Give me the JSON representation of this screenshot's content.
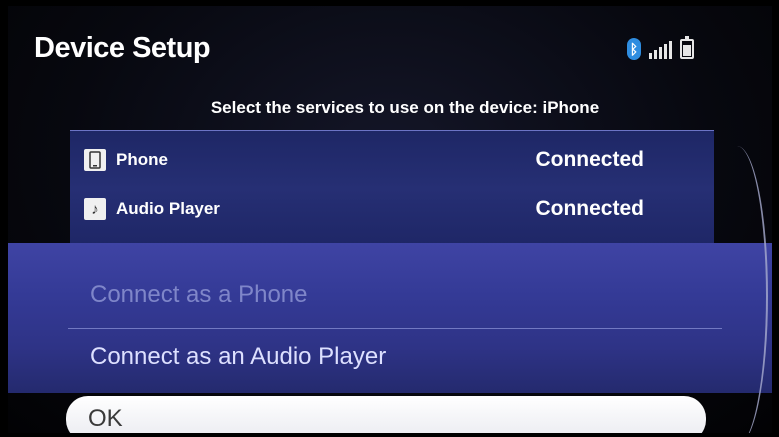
{
  "header": {
    "title": "Device Setup"
  },
  "status_icons": {
    "bluetooth": "bluetooth-icon",
    "signal": "signal-icon",
    "battery": "battery-icon"
  },
  "subtitle": "Select the services to use on the device: iPhone",
  "services": [
    {
      "name": "Phone",
      "status": "Connected",
      "icon": "phone-icon"
    },
    {
      "name": "Audio Player",
      "status": "Connected",
      "icon": "music-note-icon"
    }
  ],
  "actions": {
    "connect_phone": "Connect as a Phone",
    "connect_audio": "Connect as an Audio Player",
    "ok": "OK"
  },
  "colors": {
    "accent": "#343a96",
    "panel": "#262f74",
    "bluetooth": "#2f8de0"
  }
}
